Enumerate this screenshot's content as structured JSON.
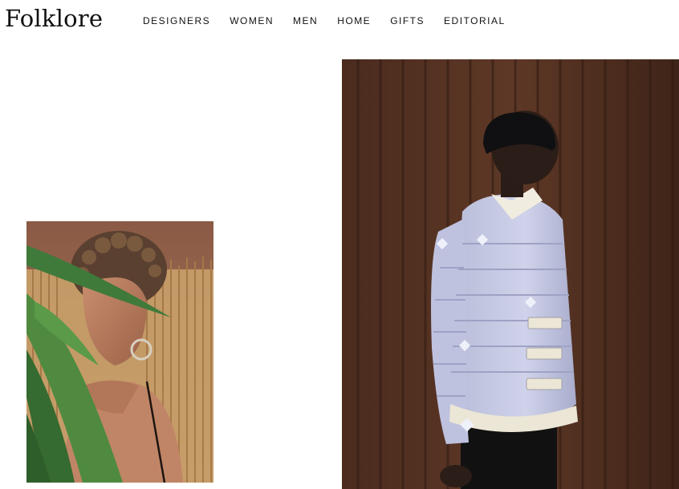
{
  "brand": {
    "name": "Folklore"
  },
  "nav": {
    "items": [
      {
        "label": "DESIGNERS"
      },
      {
        "label": "WOMEN"
      },
      {
        "label": "MEN"
      },
      {
        "label": "HOME"
      },
      {
        "label": "GIFTS"
      },
      {
        "label": "EDITORIAL"
      }
    ]
  },
  "colors": {
    "text": "#111111",
    "background": "#ffffff",
    "rust_wall": "#5a3524",
    "jacket": "#c9cbe2"
  }
}
